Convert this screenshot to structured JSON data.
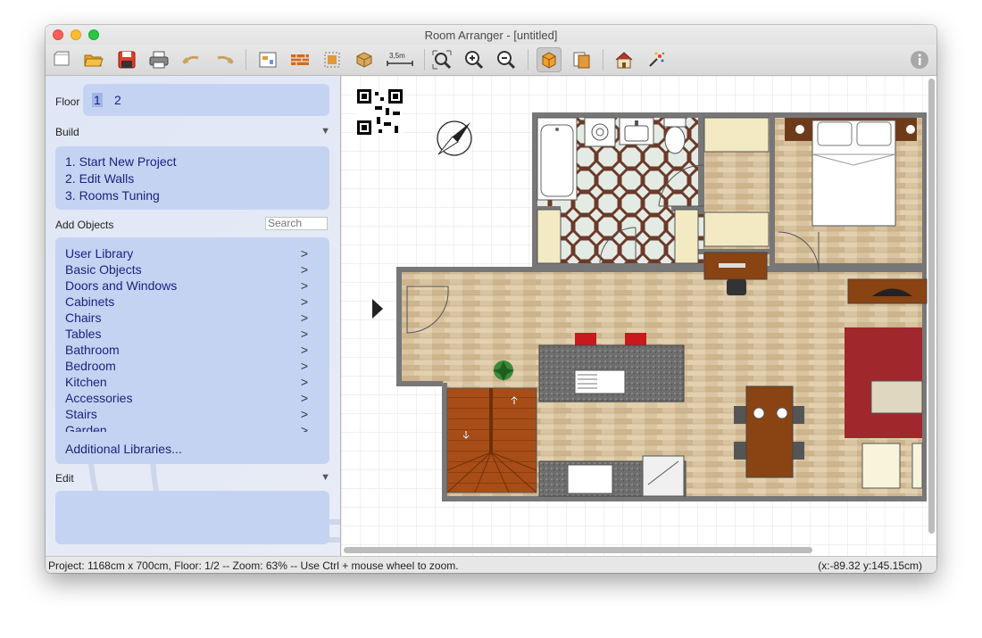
{
  "window": {
    "title": "Room Arranger - [untitled]"
  },
  "toolbar": {
    "buttons": [
      {
        "name": "new-icon"
      },
      {
        "name": "open-icon"
      },
      {
        "name": "save-icon"
      },
      {
        "name": "print-icon"
      },
      {
        "name": "undo-icon"
      },
      {
        "name": "redo-icon"
      },
      {
        "name": "room-icon"
      },
      {
        "name": "wall-icon"
      },
      {
        "name": "select-icon"
      },
      {
        "name": "object-icon"
      },
      {
        "name": "measure-icon",
        "label": "3,5m"
      },
      {
        "name": "zoom-fit-icon"
      },
      {
        "name": "zoom-in-icon"
      },
      {
        "name": "zoom-out-icon"
      },
      {
        "name": "view-2d-icon"
      },
      {
        "name": "view-3d-icon"
      },
      {
        "name": "house-icon"
      },
      {
        "name": "fireworks-icon"
      },
      {
        "name": "info-icon"
      }
    ]
  },
  "sidebar": {
    "floor": {
      "label": "Floor",
      "items": [
        "1",
        "2"
      ],
      "selected": "1"
    },
    "build": {
      "label": "Build",
      "items": [
        "1. Start New Project",
        "2. Edit Walls",
        "3. Rooms Tuning"
      ]
    },
    "add_objects": {
      "label": "Add Objects",
      "search_placeholder": "Search",
      "chevron": ">",
      "items": [
        "User Library",
        "Basic Objects",
        "Doors and Windows",
        "Cabinets",
        "Chairs",
        "Tables",
        "Bathroom",
        "Bedroom",
        "Kitchen",
        "Accessories",
        "Stairs",
        "Garden"
      ],
      "additional": "Additional Libraries..."
    },
    "edit": {
      "label": "Edit"
    }
  },
  "status": {
    "left": "Project: 1168cm x 700cm, Floor: 1/2 -- Zoom: 63% -- Use Ctrl + mouse wheel to zoom.",
    "right": "(x:-89.32 y:145.15cm)"
  }
}
